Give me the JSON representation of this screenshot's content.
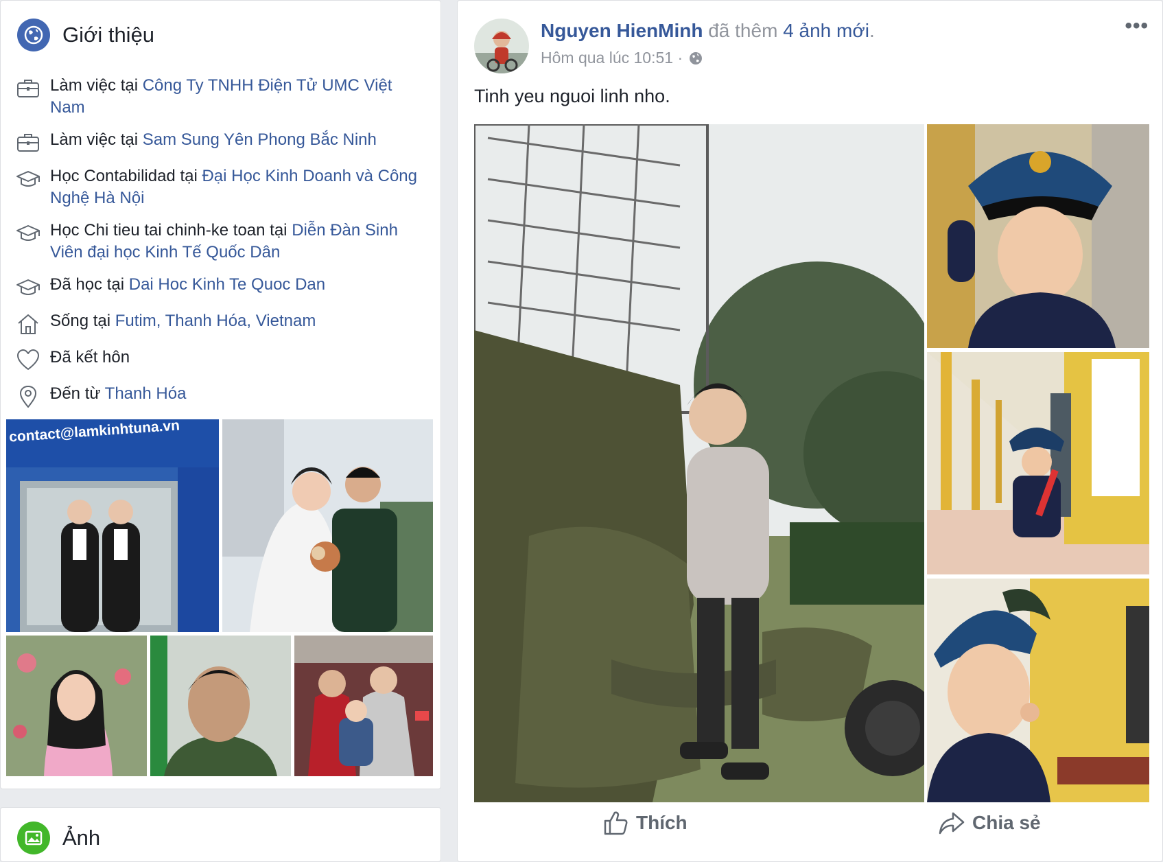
{
  "intro": {
    "title": "Giới thiệu",
    "items": [
      {
        "icon": "briefcase-icon",
        "prefix": "Làm việc tại ",
        "link": "Công Ty TNHH Điện Tử UMC Việt Nam"
      },
      {
        "icon": "briefcase-icon",
        "prefix": "Làm việc tại ",
        "link": "Sam Sung Yên Phong Bắc Ninh"
      },
      {
        "icon": "graduation-cap-icon",
        "prefix": "Học Contabilidad tại ",
        "link": "Đại Học Kinh Doanh và Công Nghệ Hà Nội"
      },
      {
        "icon": "graduation-cap-icon",
        "prefix": "Học Chi tieu tai chinh-ke toan tại ",
        "link": "Diễn Đàn Sinh Viên đại học Kinh Tế Quốc Dân"
      },
      {
        "icon": "graduation-cap-icon",
        "prefix": "Đã học tại ",
        "link": "Dai Hoc Kinh Te Quoc Dan"
      },
      {
        "icon": "home-icon",
        "prefix": "Sống tại ",
        "link": "Futim, Thanh Hóa, Vietnam"
      },
      {
        "icon": "heart-icon",
        "prefix": "Đã kết hôn",
        "link": ""
      },
      {
        "icon": "location-pin-icon",
        "prefix": "Đến từ ",
        "link": "Thanh Hóa"
      }
    ],
    "photo_sign_text": "contact@lamkinhtuna.vn"
  },
  "photos_section": {
    "title": "Ảnh"
  },
  "post": {
    "author": "Nguyen HienMinh",
    "action_text": " đã thêm ",
    "count_link": "4 ảnh mới",
    "period": ".",
    "timestamp": "Hôm qua lúc 10:51 ·",
    "more": "•••",
    "text": "Tinh yeu nguoi linh nho.",
    "like_label": "Thích",
    "share_label": "Chia sẻ"
  },
  "colors": {
    "link": "#365899",
    "globe_badge": "#4267b2",
    "photos_badge": "#42b72a",
    "muted": "#90949c"
  }
}
